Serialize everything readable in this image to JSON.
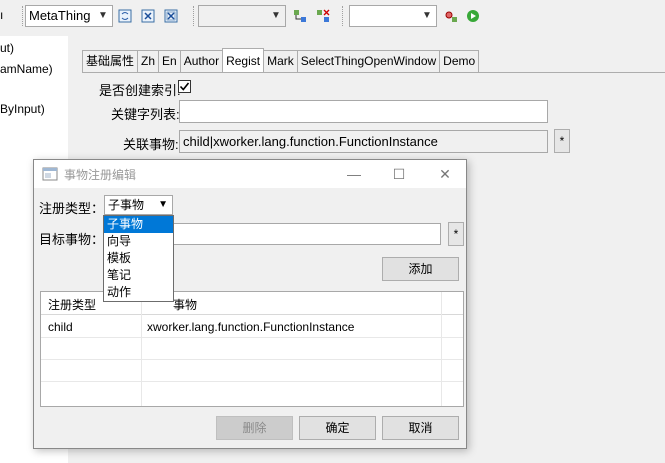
{
  "toolbar": {
    "thing_combo_value": "MetaThing",
    "empty_combo_value": "",
    "search_combo_value": ""
  },
  "left_panel": {
    "lines": [
      "ut)",
      "amName)",
      "ByInput)"
    ]
  },
  "tabs": [
    {
      "label": "基础属性"
    },
    {
      "label": "Zh"
    },
    {
      "label": "En"
    },
    {
      "label": "Author"
    },
    {
      "label": "Regist"
    },
    {
      "label": "Mark"
    },
    {
      "label": "SelectThingOpenWindow"
    },
    {
      "label": "Demo"
    }
  ],
  "active_tab": "Regist",
  "form": {
    "create_index_label": "是否创建索引:",
    "create_index_checked": true,
    "keywords_label": "关键字列表:",
    "keywords_value": "",
    "related_label": "关联事物:",
    "related_value": "child|xworker.lang.function.FunctionInstance",
    "star": "*"
  },
  "dialog": {
    "title": "事物注册编辑",
    "type_label": "注册类型：",
    "type_value": "子事物",
    "target_label": "目标事物：",
    "target_value": "",
    "star": "*",
    "add_button": "添加",
    "table": {
      "headers": [
        "注册类型",
        "事物"
      ],
      "rows": [
        [
          "child",
          "xworker.lang.function.FunctionInstance"
        ]
      ]
    },
    "delete_button": "删除",
    "ok_button": "确定",
    "cancel_button": "取消"
  },
  "dropdown": {
    "options": [
      "子事物",
      "向导",
      "模板",
      "笔记",
      "动作"
    ],
    "selected": "子事物"
  }
}
